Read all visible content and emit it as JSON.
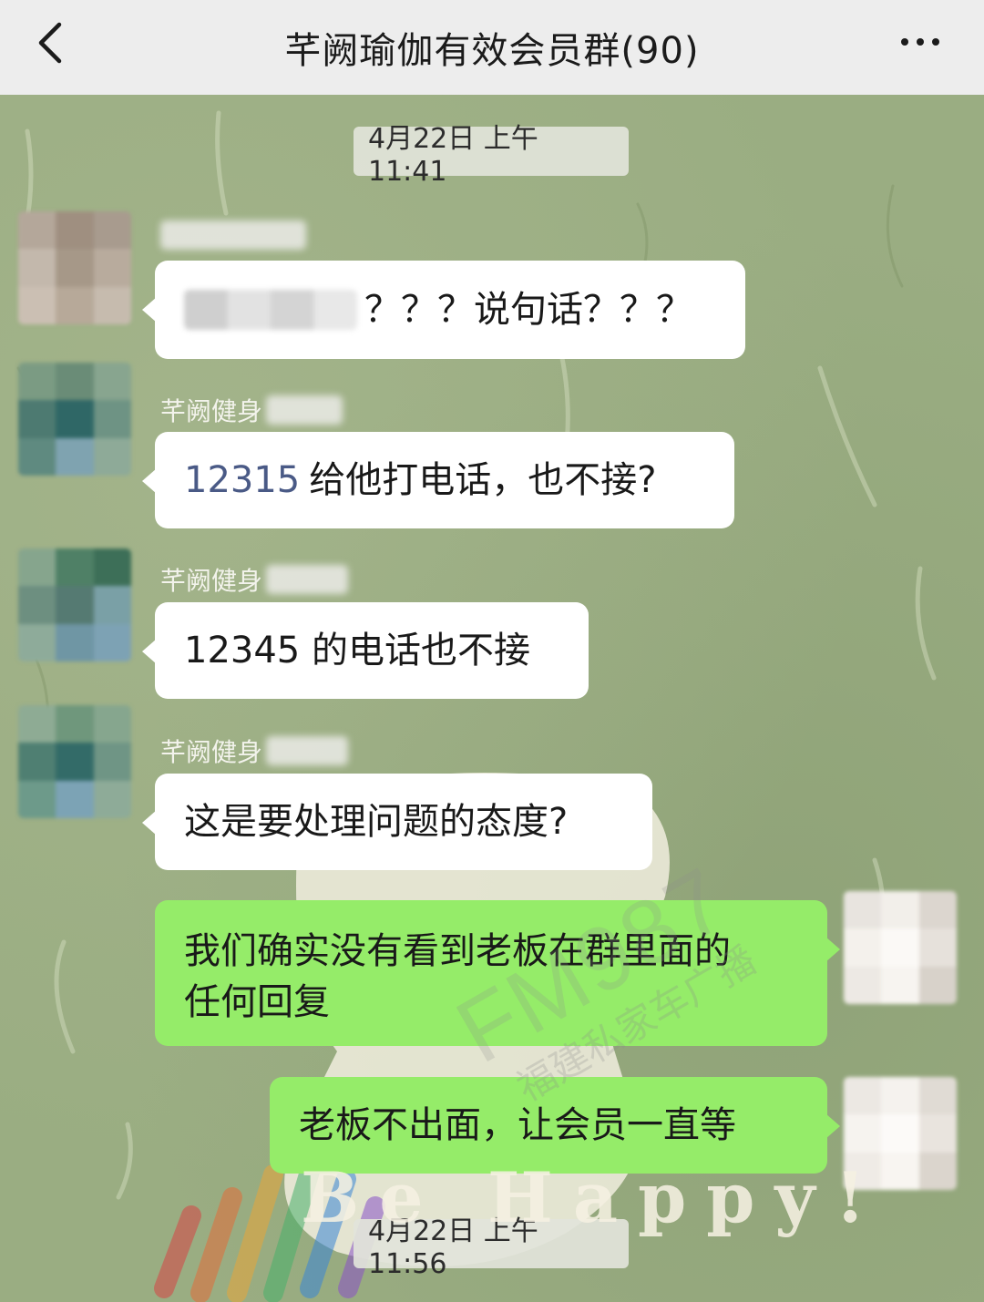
{
  "header": {
    "title": "芊阙瑜伽有效会员群(90)"
  },
  "timestamps": [
    "4月22日 上午11:41",
    "4月22日 上午11:56"
  ],
  "messages": [
    {
      "sender": "",
      "text": "？？？说句话？？？",
      "direction": "incoming"
    },
    {
      "sender": "芊阙健身",
      "phone": "12315",
      "text": "给他打电话，也不接?",
      "direction": "incoming"
    },
    {
      "sender": "芊阙健身",
      "text": "12345 的电话也不接",
      "direction": "incoming"
    },
    {
      "sender": "芊阙健身",
      "text": "这是要处理问题的态度?",
      "direction": "incoming"
    },
    {
      "text_line1": "我们确实没有看到老板在群里面的",
      "text_line2": "任何回复",
      "direction": "outgoing"
    },
    {
      "text": "老板不出面，让会员一直等",
      "direction": "outgoing"
    }
  ],
  "watermark": {
    "brand": "FM987",
    "subtitle": "福建私家车广播"
  },
  "background_text": "Be Happy!",
  "colors": {
    "header_bg": "#ededed",
    "chat_bg": "#9aad82",
    "bubble_in": "#ffffff",
    "bubble_out": "#95ec69",
    "link": "#4a5a86"
  },
  "icons": [
    "back-arrow-icon",
    "more-dots-icon"
  ]
}
